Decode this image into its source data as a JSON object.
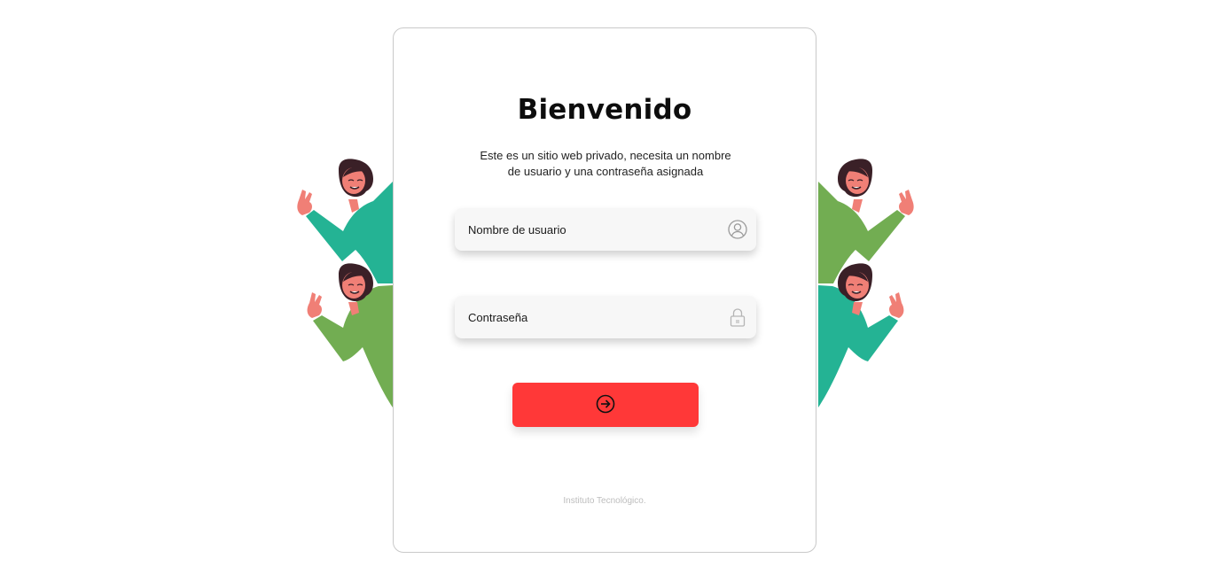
{
  "login": {
    "title": "Bienvenido",
    "description": "Este es un sitio web privado, necesita un nombre de usuario y una contraseña asignada",
    "username_placeholder": "Nombre de usuario",
    "password_placeholder": "Contraseña",
    "username_icon": "user-circle-icon",
    "password_icon": "lock-icon",
    "submit_icon": "login-arrow-icon",
    "footer": "Instituto Tecnológico."
  },
  "colors": {
    "accent": "#ff3838",
    "card_border": "#c9c9c9",
    "field_bg": "#f7f7f7",
    "shirt_teal": "#24b394",
    "shirt_green": "#72ad52",
    "skin": "#f07f76",
    "hair": "#3a2027",
    "footer_text": "#bdbdbd"
  },
  "decorations": {
    "left": "waving-women-illustration",
    "right": "waving-women-illustration"
  }
}
